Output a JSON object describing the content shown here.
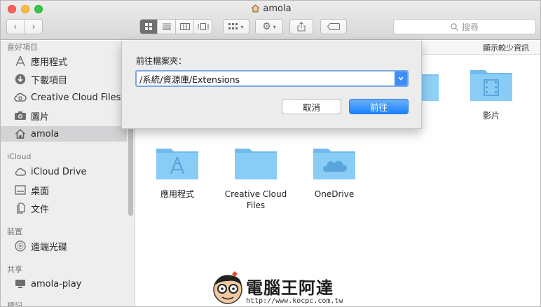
{
  "window": {
    "title": "amola"
  },
  "toolbar": {
    "search_placeholder": "搜尋"
  },
  "sidebar": {
    "sections": [
      {
        "label": "喜好項目"
      },
      {
        "label": "iCloud"
      },
      {
        "label": "裝置"
      },
      {
        "label": "共享"
      },
      {
        "label": "標記"
      }
    ],
    "favorites": [
      {
        "label": "應用程式",
        "icon": "applications-icon"
      },
      {
        "label": "下載項目",
        "icon": "downloads-icon"
      },
      {
        "label": "Creative Cloud Files",
        "icon": "creative-cloud-icon"
      },
      {
        "label": "圖片",
        "icon": "pictures-icon"
      },
      {
        "label": "amola",
        "icon": "home-icon",
        "selected": true
      }
    ],
    "icloud": [
      {
        "label": "iCloud Drive",
        "icon": "cloud-icon"
      },
      {
        "label": "桌面",
        "icon": "desktop-icon"
      },
      {
        "label": "文件",
        "icon": "documents-icon"
      }
    ],
    "devices": [
      {
        "label": "遠端光碟",
        "icon": "disc-icon"
      }
    ],
    "shared": [
      {
        "label": "amola-play",
        "icon": "computer-icon"
      }
    ]
  },
  "main": {
    "show_less": "顯示較少資訊",
    "folders": [
      {
        "label": "影片",
        "icon": "movies-folder-icon"
      },
      {
        "label": "應用程式",
        "icon": "applications-folder-icon"
      },
      {
        "label": "Creative Cloud Files",
        "icon": "folder-icon"
      },
      {
        "label": "OneDrive",
        "icon": "onedrive-folder-icon"
      }
    ]
  },
  "go_to_folder": {
    "prompt": "前往檔案夾：",
    "path": "/系統/資源庫/Extensions",
    "cancel_label": "取消",
    "go_label": "前往"
  },
  "watermark": {
    "text": "電腦王阿達",
    "url": "http://www.kocpc.com.tw"
  },
  "colors": {
    "folder": "#7cc4f2",
    "accent": "#1a82fb",
    "selected_row": "#d3d3d5"
  }
}
